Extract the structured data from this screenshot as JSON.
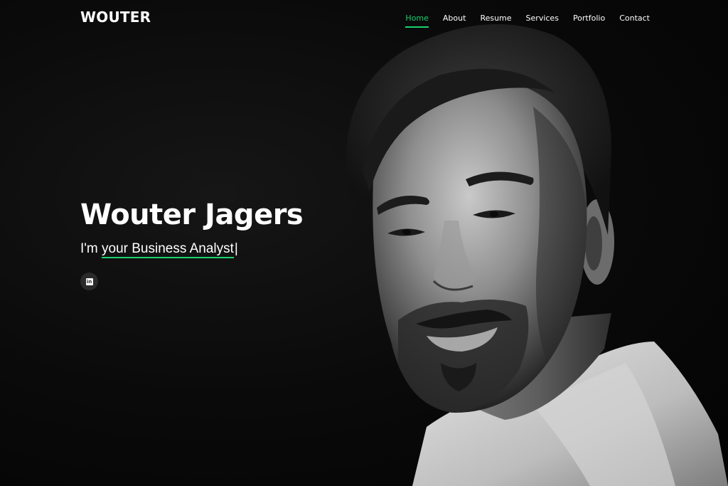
{
  "header": {
    "logo": "WOUTER",
    "nav": [
      {
        "label": "Home",
        "active": true
      },
      {
        "label": "About",
        "active": false
      },
      {
        "label": "Resume",
        "active": false
      },
      {
        "label": "Services",
        "active": false
      },
      {
        "label": "Portfolio",
        "active": false
      },
      {
        "label": "Contact",
        "active": false
      }
    ]
  },
  "hero": {
    "name": "Wouter Jagers",
    "tagline_prefix": "I'm ",
    "tagline_typed": "your Business Analyst",
    "cursor": "|",
    "social": [
      {
        "icon": "linkedin-icon",
        "glyph": "in"
      }
    ]
  },
  "colors": {
    "accent": "#18d26e",
    "background": "#050505",
    "text": "#ffffff"
  }
}
